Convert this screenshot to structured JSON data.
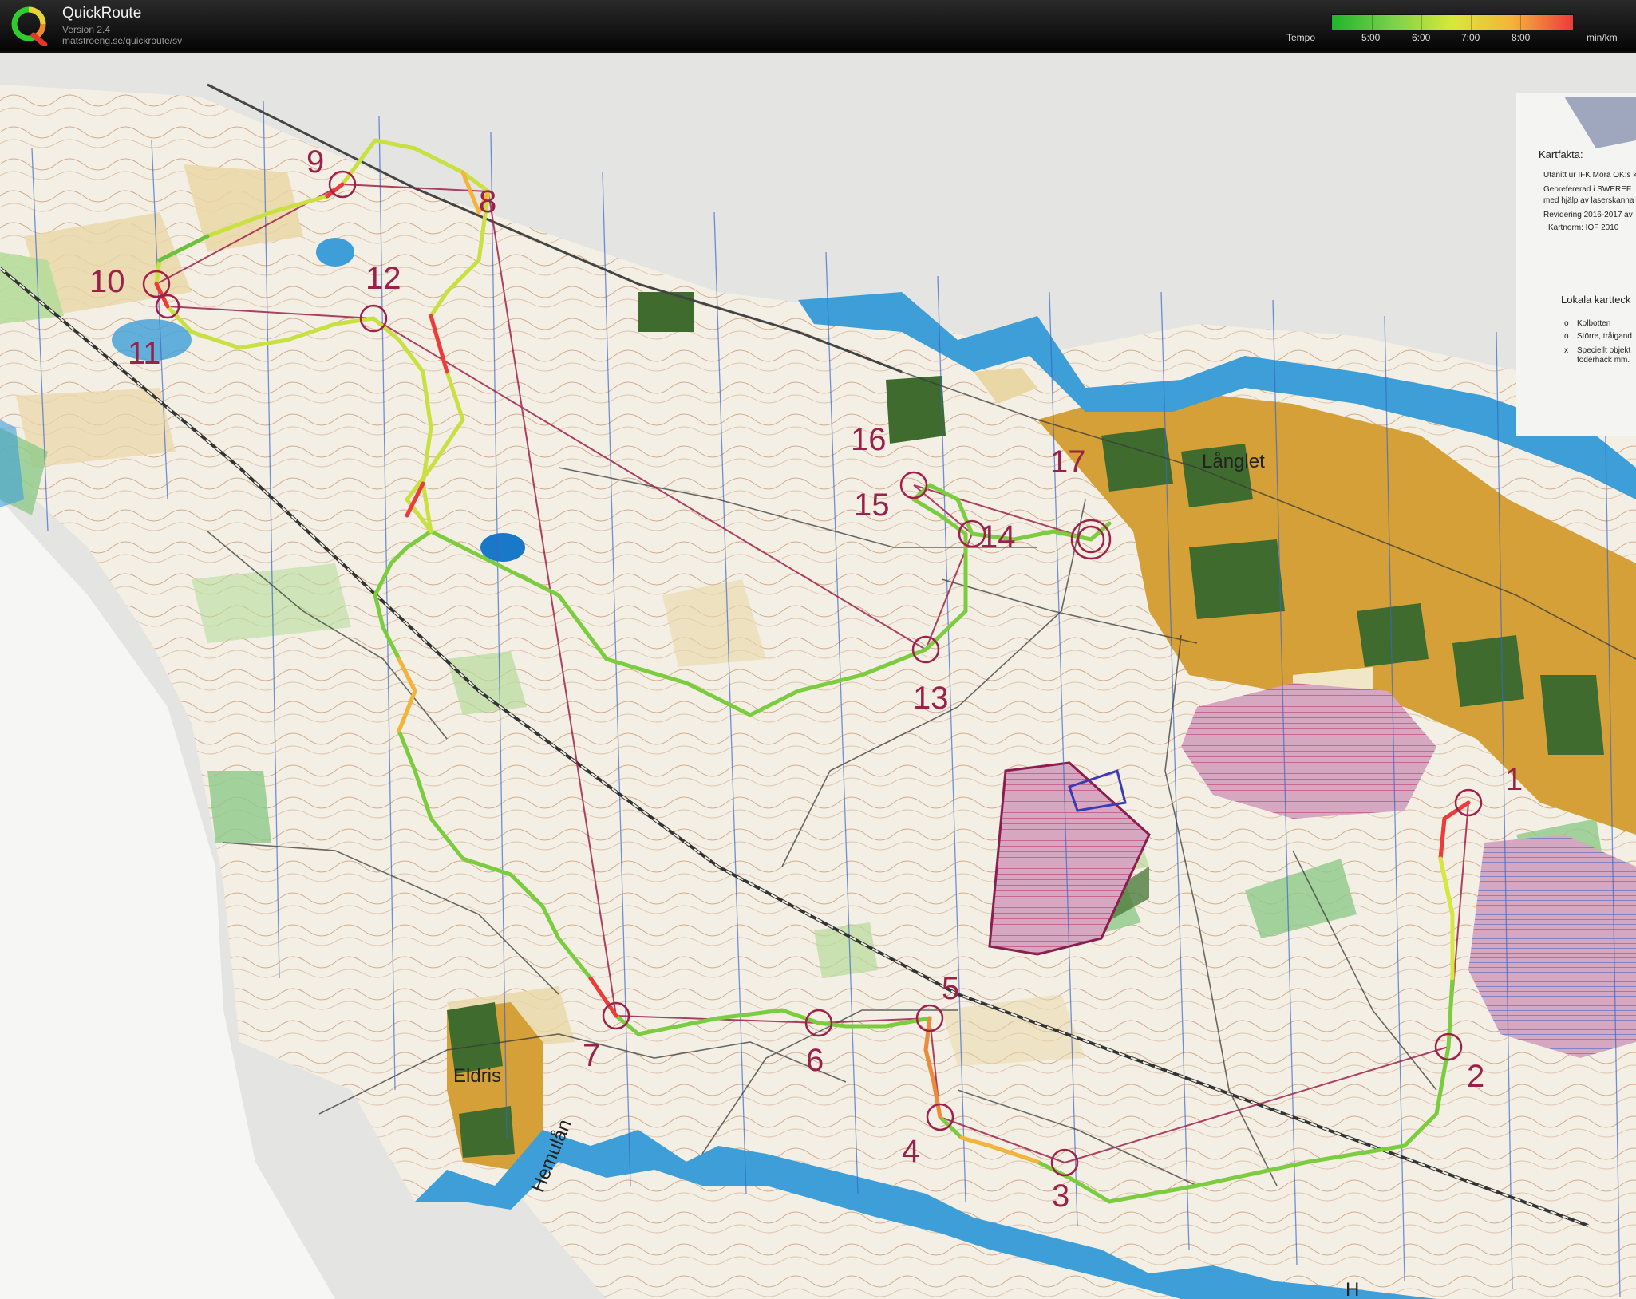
{
  "app": {
    "title": "QuickRoute",
    "version": "Version 2.4",
    "url": "matstroeng.se/quickroute/sv"
  },
  "legend": {
    "label": "Tempo",
    "ticks": [
      "5:00",
      "6:00",
      "7:00",
      "8:00"
    ],
    "unit": "min/km",
    "colors": [
      "#1fb52a",
      "#7ad04a",
      "#d8e83a",
      "#f4b33a",
      "#ee3a3a"
    ]
  },
  "map": {
    "places": {
      "langlet": "Långlet",
      "eldris": "Eldris",
      "hemulan": "Hemulån",
      "bottom_clip": "H"
    },
    "info_panel": {
      "title": "Kartfakta:",
      "lines": [
        "Utanitt ur IFK Mora OK:s k",
        "Georefererad i SWEREF",
        "med hjälp av laserskanna",
        "Revidering 2016-2017 av",
        "Kartnorm: IOF 2010"
      ],
      "local_title": "Lokala kartteck",
      "local_items": [
        "Kolbotten",
        "Större, tråigand",
        "Speciellt objekt",
        "foderhäck mm."
      ],
      "local_markers": [
        "o",
        "o",
        "x"
      ]
    },
    "controls": [
      "1",
      "2",
      "3",
      "4",
      "5",
      "6",
      "7",
      "8",
      "9",
      "10",
      "11",
      "12",
      "13",
      "14",
      "15",
      "16",
      "17"
    ],
    "colors": {
      "paper": "#f4f1ea",
      "open_land": "#ead7a6",
      "forest_green": "#b7dc9b",
      "dark_green": "#3f6b2f",
      "water": "#3e9fd8",
      "settlement": "#d4a037",
      "course": "#a0204a",
      "north_lines": "#3a66c8",
      "contour": "#b9703e",
      "railway": "#333333"
    }
  }
}
